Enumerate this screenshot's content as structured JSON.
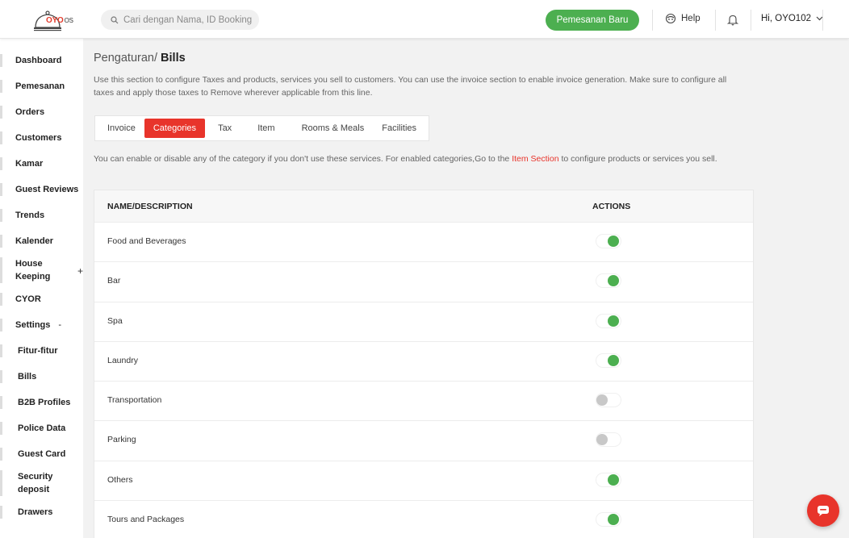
{
  "header": {
    "logo_text": "OYO",
    "logo_suffix": "OS",
    "search_placeholder": "Cari dengan Nama, ID Booking",
    "new_booking_label": "Pemesanan Baru",
    "help_label": "Help",
    "user_label": "Hi, OYO102"
  },
  "sidebar": {
    "items": [
      {
        "label": "Dashboard"
      },
      {
        "label": "Pemesanan"
      },
      {
        "label": "Orders"
      },
      {
        "label": "Customers"
      },
      {
        "label": "Kamar"
      },
      {
        "label": "Guest Reviews"
      },
      {
        "label": "Trends"
      },
      {
        "label": "Kalender"
      },
      {
        "label": "House Keeping",
        "expander": "+"
      },
      {
        "label": "CYOR"
      },
      {
        "label": "Settings",
        "expander": "-"
      },
      {
        "label": "Fitur-fitur"
      },
      {
        "label": "Bills"
      },
      {
        "label": "B2B Profiles"
      },
      {
        "label": "Police Data"
      },
      {
        "label": "Guest Card"
      },
      {
        "label": "Security deposit"
      },
      {
        "label": "Drawers"
      }
    ]
  },
  "page": {
    "breadcrumb_parent": "Pengaturan/",
    "breadcrumb_current": "Bills",
    "description": "Use this section to configure Taxes and products, services you sell to customers. You can use the invoice section to enable invoice generation. Make sure to configure all taxes and apply those taxes to Remove wherever applicable from this line.",
    "tabs": [
      "Invoice",
      "Categories",
      "Tax",
      "Item",
      "Rooms & Meals",
      "Facilities"
    ],
    "active_tab": "Categories",
    "note_before": "You can enable or disable any of the category if you don't use these services. For enabled categories,Go to the ",
    "note_link": "Item Section",
    "note_after": " to configure products or services you sell."
  },
  "table": {
    "headers": [
      "NAME/DESCRIPTION",
      "ACTIONS"
    ],
    "rows": [
      {
        "name": "Food and Beverages",
        "enabled": true
      },
      {
        "name": "Bar",
        "enabled": true
      },
      {
        "name": "Spa",
        "enabled": true
      },
      {
        "name": "Laundry",
        "enabled": true
      },
      {
        "name": "Transportation",
        "enabled": false
      },
      {
        "name": "Parking",
        "enabled": false
      },
      {
        "name": "Others",
        "enabled": true
      },
      {
        "name": "Tours and Packages",
        "enabled": true
      }
    ]
  },
  "colors": {
    "accent_red": "#e8342b",
    "toggle_on": "#4caf50",
    "toggle_off": "#c8c8c8"
  }
}
